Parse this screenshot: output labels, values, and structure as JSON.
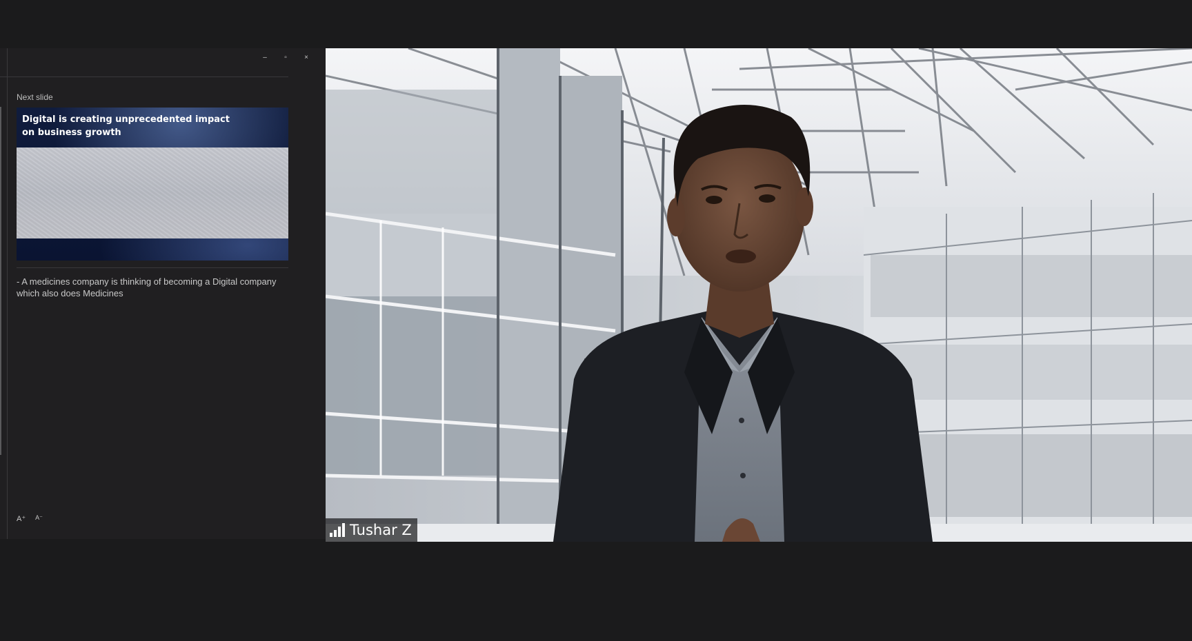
{
  "panel": {
    "window_controls": {
      "minimize": "–",
      "restore": "▫",
      "close": "×"
    },
    "next_slide_label": "Next slide",
    "next_slide_title": "Digital is creating unprecedented impact on business growth",
    "notes_text": "- A medicines company is thinking of becoming a Digital company which also does Medicines",
    "font_increase": "A⁺",
    "font_decrease": "A⁻"
  },
  "video": {
    "participant_name": "Tushar Z",
    "signal_icon": "signal-bars-icon"
  },
  "colors": {
    "background": "#1b1b1c",
    "panel": "#201f21",
    "slide_title": "#ffffff"
  }
}
